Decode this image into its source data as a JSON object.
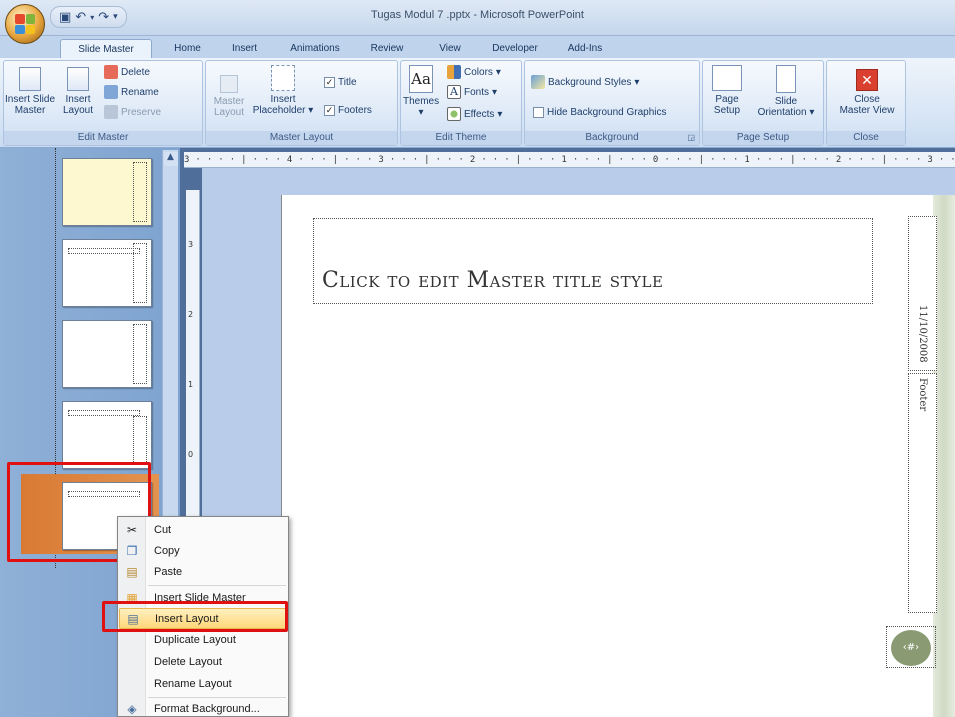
{
  "window": {
    "title": "Tugas Modul 7 .pptx - Microsoft PowerPoint"
  },
  "tabs": [
    "Slide Master",
    "Home",
    "Insert",
    "Animations",
    "Review",
    "View",
    "Developer",
    "Add-Ins"
  ],
  "ribbon": {
    "edit_master": {
      "label": "Edit Master",
      "insert_slide_master": "Insert Slide",
      "insert_slide_master2": "Master",
      "insert_layout": "Insert",
      "insert_layout2": "Layout",
      "delete": "Delete",
      "rename": "Rename",
      "preserve": "Preserve"
    },
    "master_layout": {
      "label": "Master Layout",
      "master_layout": "Master",
      "master_layout2": "Layout",
      "insert_placeholder": "Insert",
      "insert_placeholder2": "Placeholder",
      "title": "Title",
      "footers": "Footers"
    },
    "edit_theme": {
      "label": "Edit Theme",
      "themes": "Themes",
      "colors": "Colors",
      "fonts": "Fonts",
      "effects": "Effects"
    },
    "background": {
      "label": "Background",
      "background_styles": "Background Styles",
      "hide_background": "Hide Background Graphics"
    },
    "page_setup": {
      "label": "Page Setup",
      "page_setup": "Page",
      "page_setup2": "Setup",
      "slide_orientation": "Slide",
      "slide_orientation2": "Orientation"
    },
    "close": {
      "label": "Close",
      "close_master": "Close",
      "close_master2": "Master View"
    }
  },
  "ruler": {
    "h": "3 · · · · | · · · 4 · · · | · · · 3 · · · | · · · 2 · · · | · · · 1 · · · | · · · 0 · · · | · · · 1 · · · | · · · 2 · · · | · · · 3 · · · | · · · 4 · · · | · ·"
  },
  "slide": {
    "title": "Click to edit Master title style",
    "date": "11/10/2008",
    "footer": "Footer",
    "number": "‹#›"
  },
  "context_menu": {
    "cut": "Cut",
    "copy": "Copy",
    "paste": "Paste",
    "insert_slide_master": "Insert Slide Master",
    "insert_layout": "Insert Layout",
    "duplicate_layout": "Duplicate Layout",
    "delete_layout": "Delete Layout",
    "rename_layout": "Rename Layout",
    "format_background": "Format Background..."
  },
  "colors": {
    "accent": "#e01010",
    "hover": "#ffd77a",
    "thumb_selected": "#e08a45"
  }
}
